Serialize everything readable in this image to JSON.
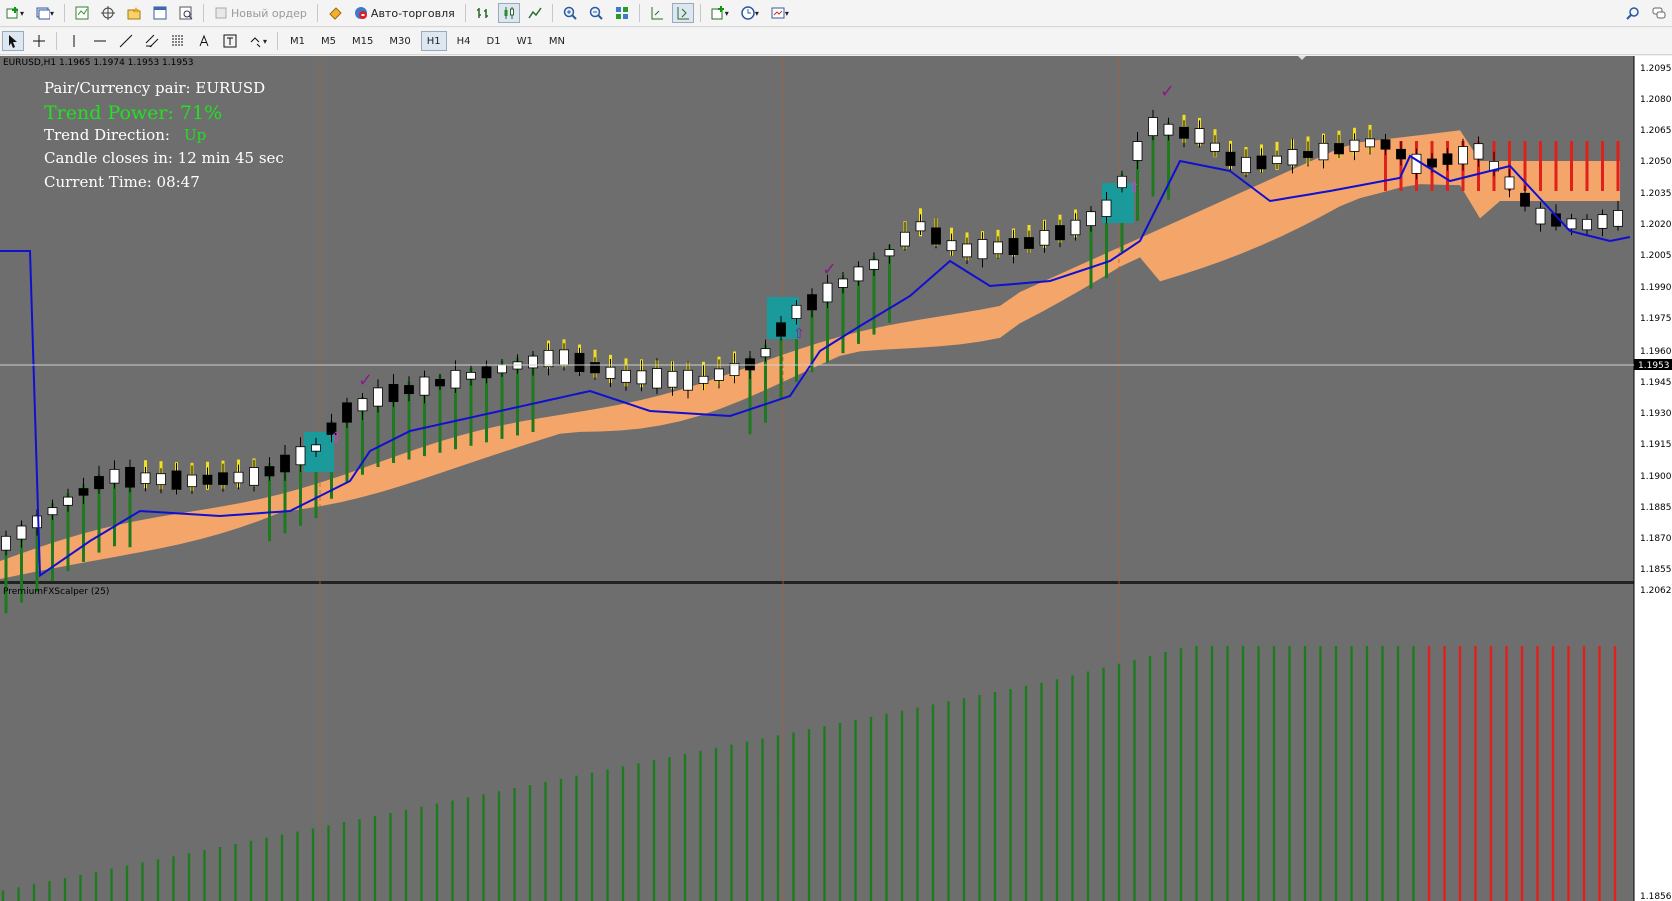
{
  "toolbar": {
    "new_order_label": "Новый ордер",
    "autotrading_label": "Авто-торговля",
    "timeframes": [
      "M1",
      "M5",
      "M15",
      "M30",
      "H1",
      "H4",
      "D1",
      "W1",
      "MN"
    ],
    "active_timeframe": "H1"
  },
  "chart": {
    "header": "EURUSD,H1  1.1965 1.1974 1.1953 1.1953",
    "info": {
      "pair": "Pair/Currency pair: EURUSD",
      "trend_power": "Trend Power: 71%",
      "trend_direction_label": "Trend Direction:",
      "trend_direction_value": "Up",
      "candle_closes": "Candle closes in: 12 min 45 sec",
      "current_time": "Current Time: 08:47"
    },
    "price_labels": [
      "1.2095",
      "1.2080",
      "1.2065",
      "1.2050",
      "1.2035",
      "1.2020",
      "1.2005",
      "1.1990",
      "1.1975",
      "1.1960",
      "1.1953",
      "1.1945",
      "1.1930",
      "1.1915",
      "1.1900",
      "1.1885",
      "1.1870",
      "1.1855"
    ],
    "current_price": "1.1953",
    "colors": {
      "bull": "#ffffff",
      "bear": "#000000",
      "ma": "#1010d0",
      "cloud": "#f4a56a",
      "trend_bar": "#1e7a1e",
      "flat_bar": "#f0e020",
      "down_bar": "#e0201a",
      "signal_box": "#1a9a9a",
      "check": "#8a1a8a",
      "background": "#6e6e6e"
    }
  },
  "indicator": {
    "label": "PremiumFXScalper (25)",
    "axis_top": "1.2062",
    "axis_bottom": "1.1856"
  }
}
